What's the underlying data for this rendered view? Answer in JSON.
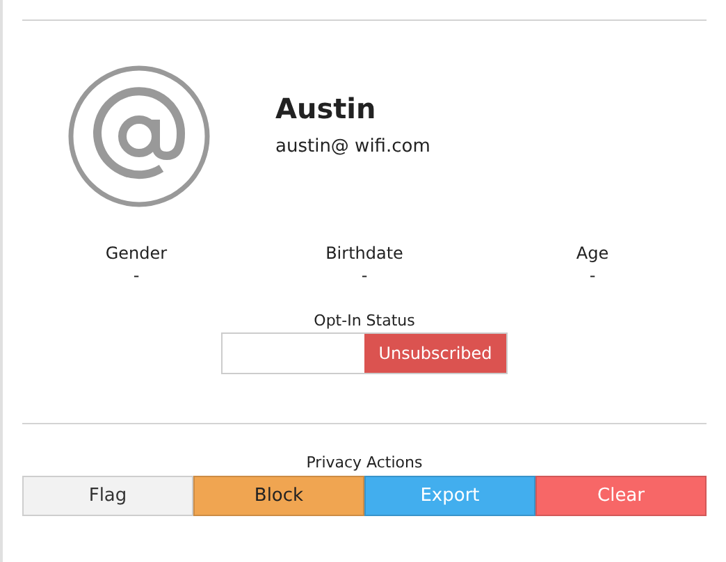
{
  "profile": {
    "name": "Austin",
    "email": "austin@ wifi.com"
  },
  "stats": [
    {
      "label": "Gender",
      "value": "-"
    },
    {
      "label": "Birthdate",
      "value": "-"
    },
    {
      "label": "Age",
      "value": "-"
    }
  ],
  "opt_in": {
    "label": "Opt-In Status",
    "status": "Unsubscribed",
    "subscribed": false
  },
  "privacy": {
    "label": "Privacy Actions",
    "buttons": [
      {
        "label": "Flag",
        "color": "#f2f2f2"
      },
      {
        "label": "Block",
        "color": "#f0a551"
      },
      {
        "label": "Export",
        "color": "#42aeee"
      },
      {
        "label": "Clear",
        "color": "#f76767"
      }
    ]
  }
}
